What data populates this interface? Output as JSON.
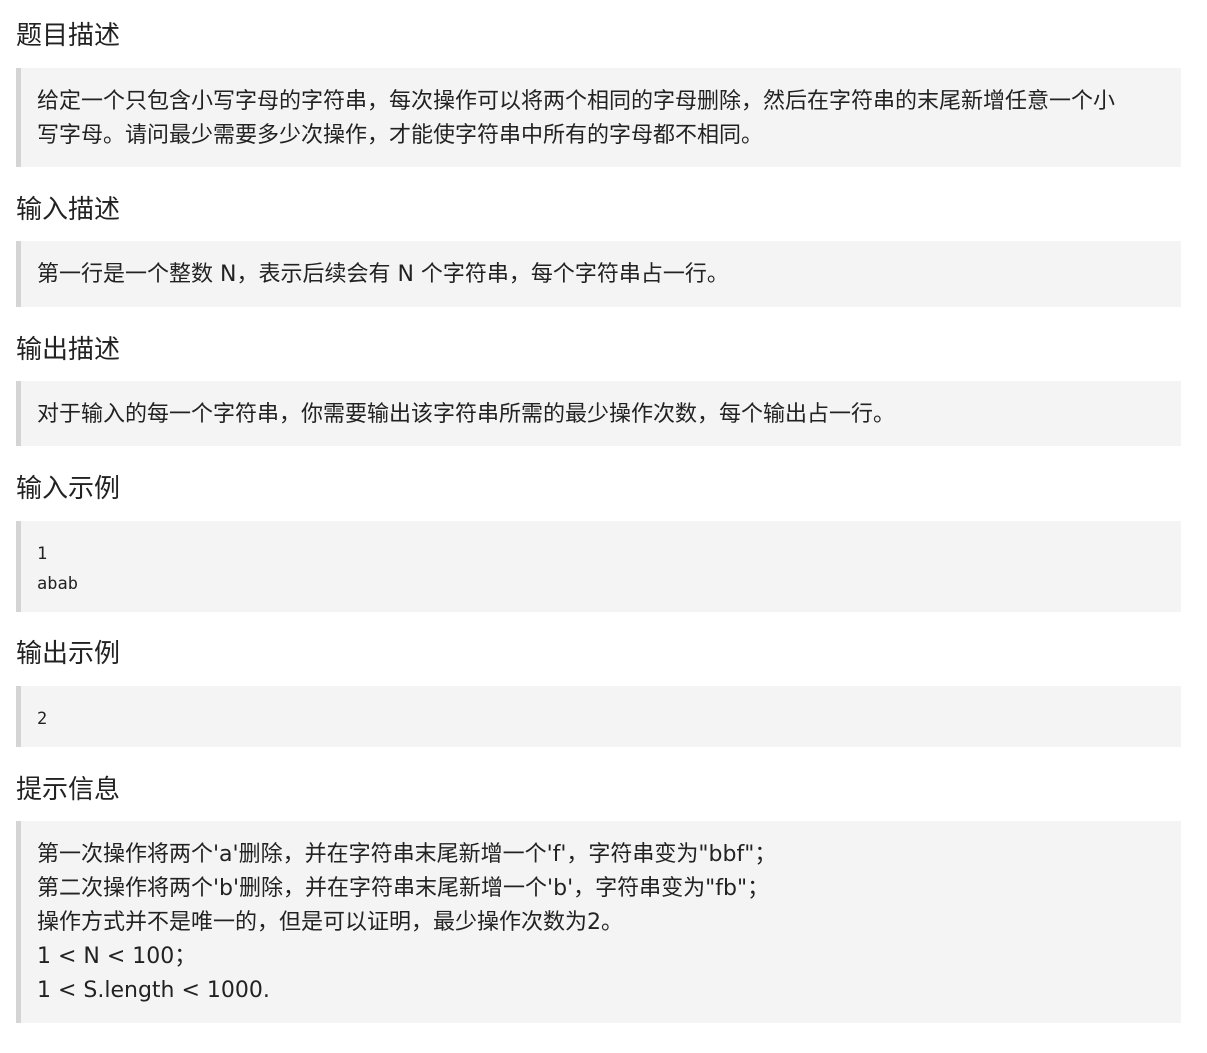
{
  "sections": {
    "description": {
      "heading": "题目描述",
      "lines": [
        "给定一个只包含小写字母的字符串，每次操作可以将两个相同的字母删除，然后在字符串的末尾新增任意一个小",
        "写字母。请问最少需要多少次操作，才能使字符串中所有的字母都不相同。"
      ]
    },
    "input_desc": {
      "heading": "输入描述",
      "lines": [
        "第一行是一个整数 N，表示后续会有 N 个字符串，每个字符串占一行。"
      ]
    },
    "output_desc": {
      "heading": "输出描述",
      "lines": [
        "对于输入的每一个字符串，你需要输出该字符串所需的最少操作次数，每个输出占一行。"
      ]
    },
    "input_example": {
      "heading": "输入示例",
      "lines": [
        "1",
        "abab"
      ]
    },
    "output_example": {
      "heading": "输出示例",
      "lines": [
        "2"
      ]
    },
    "hints": {
      "heading": "提示信息",
      "lines": [
        "第一次操作将两个'a'删除，并在字符串末尾新增一个'f'，字符串变为\"bbf\"；",
        "第二次操作将两个'b'删除，并在字符串末尾新增一个'b'，字符串变为\"fb\"；",
        "操作方式并不是唯一的，但是可以证明，最少操作次数为2。",
        "1 < N < 100；",
        "1 < S.length < 1000."
      ]
    }
  }
}
